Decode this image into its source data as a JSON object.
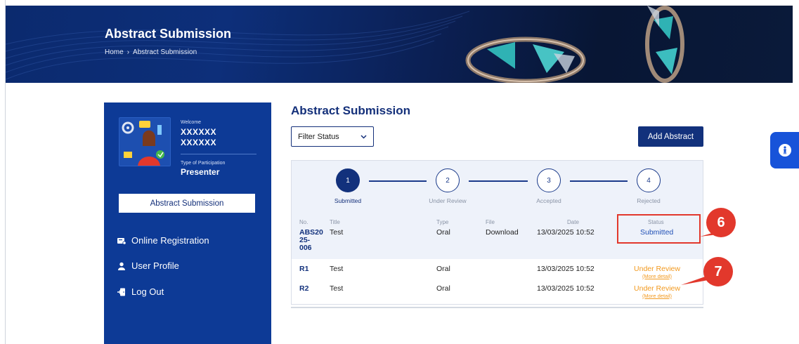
{
  "banner": {
    "title": "Abstract Submission",
    "breadcrumb": [
      "Home",
      "Abstract Submission"
    ],
    "breadcrumb_sep": "›"
  },
  "sidebar": {
    "welcome_label": "Welcome",
    "user_first": "XXXXXX",
    "user_last": "XXXXXX",
    "participation_label": "Type of Participation",
    "participation_value": "Presenter",
    "primary_button": "Abstract Submission",
    "nav": [
      {
        "label": "Online Registration",
        "icon": "registration-icon"
      },
      {
        "label": "User Profile",
        "icon": "user-icon"
      },
      {
        "label": "Log Out",
        "icon": "logout-icon"
      }
    ]
  },
  "main": {
    "title": "Abstract Submission",
    "filter_label": "Filter Status",
    "add_button": "Add Abstract",
    "steps": [
      {
        "number": "1",
        "label": "Submitted",
        "active": true
      },
      {
        "number": "2",
        "label": "Under Review",
        "active": false
      },
      {
        "number": "3",
        "label": "Accepted",
        "active": false
      },
      {
        "number": "4",
        "label": "Rejected",
        "active": false
      }
    ],
    "columns": {
      "no": "No.",
      "title": "Title",
      "type": "Type",
      "file": "File",
      "date": "Date",
      "status": "Status"
    },
    "main_row": {
      "no_lines": [
        "ABS20",
        "25-",
        "006"
      ],
      "title": "Test",
      "type": "Oral",
      "file": "Download",
      "date": "13/03/2025 10:52",
      "status": "Submitted"
    },
    "revisions": [
      {
        "no": "R1",
        "title": "Test",
        "type": "Oral",
        "date": "13/03/2025 10:52",
        "status": "Under Review",
        "link": "(More detail)"
      },
      {
        "no": "R2",
        "title": "Test",
        "type": "Oral",
        "date": "13/03/2025 10:52",
        "status": "Under Review",
        "link": "(More detail)"
      }
    ]
  },
  "annotations": [
    {
      "label": "6"
    },
    {
      "label": "7"
    }
  ],
  "colors": {
    "brand_navy": "#12317c",
    "sidebar_blue": "#0d3a96",
    "accent_orange": "#f29a20",
    "callout_red": "#e2382c",
    "accessibility_blue": "#1753d9"
  },
  "accessibility": {
    "icon": "accessibility-icon"
  }
}
